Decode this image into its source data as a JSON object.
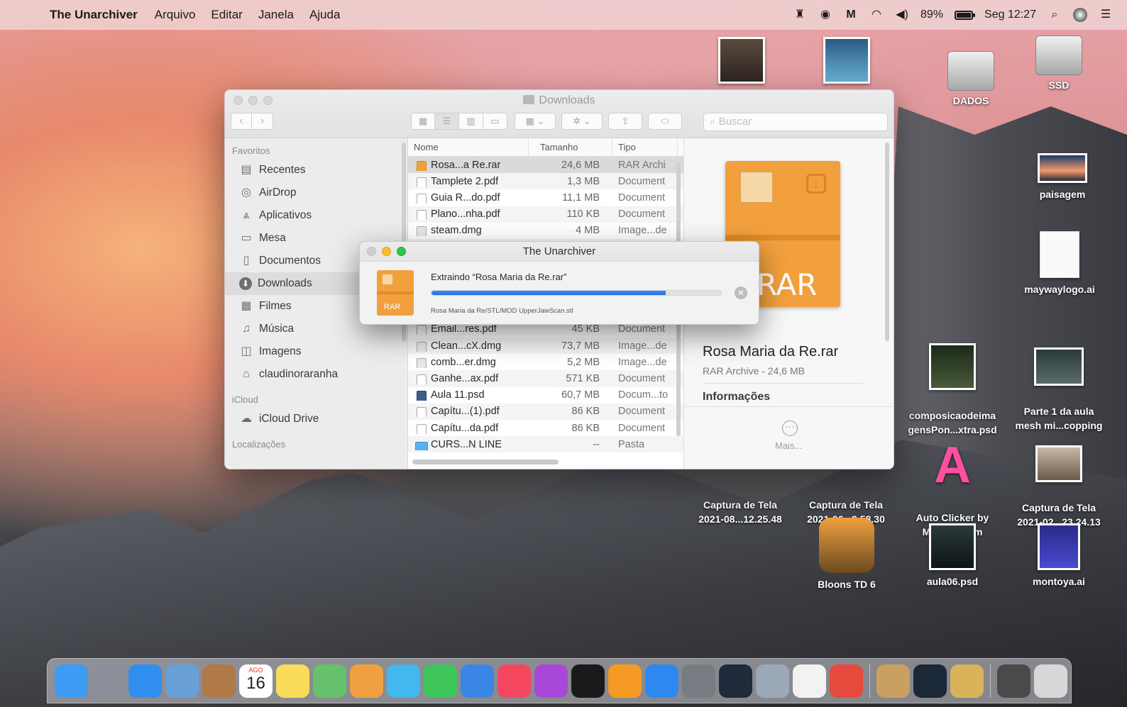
{
  "menubar": {
    "app_name": "The Unarchiver",
    "items": [
      "Arquivo",
      "Editar",
      "Janela",
      "Ajuda"
    ],
    "battery": "89%",
    "battery_level": 0.89,
    "clock": "Seg 12:27"
  },
  "finder": {
    "title": "Downloads",
    "search_placeholder": "Buscar",
    "sidebar": {
      "favorites_label": "Favoritos",
      "favorites": [
        {
          "label": "Recentes",
          "icon": "recents-icon"
        },
        {
          "label": "AirDrop",
          "icon": "airdrop-icon"
        },
        {
          "label": "Aplicativos",
          "icon": "applications-icon"
        },
        {
          "label": "Mesa",
          "icon": "desktop-icon"
        },
        {
          "label": "Documentos",
          "icon": "documents-icon"
        },
        {
          "label": "Downloads",
          "icon": "downloads-icon"
        },
        {
          "label": "Filmes",
          "icon": "movies-icon"
        },
        {
          "label": "Música",
          "icon": "music-icon"
        },
        {
          "label": "Imagens",
          "icon": "pictures-icon"
        },
        {
          "label": "claudinoraranha",
          "icon": "home-icon"
        }
      ],
      "icloud_label": "iCloud",
      "icloud_drive": "iCloud Drive",
      "locations_label": "Localizações"
    },
    "columns": {
      "name": "Nome",
      "size": "Tamanho",
      "kind": "Tipo"
    },
    "files": [
      {
        "name": "Rosa...a Re.rar",
        "size": "24,6 MB",
        "kind": "RAR Archi",
        "type": "rar"
      },
      {
        "name": "Tamplete 2.pdf",
        "size": "1,3 MB",
        "kind": "Document",
        "type": "pdf"
      },
      {
        "name": "Guia R...do.pdf",
        "size": "11,1 MB",
        "kind": "Document",
        "type": "pdf"
      },
      {
        "name": "Plano...nha.pdf",
        "size": "110 KB",
        "kind": "Document",
        "type": "pdf"
      },
      {
        "name": "steam.dmg",
        "size": "4 MB",
        "kind": "Image...de",
        "type": "dmg"
      },
      {
        "name": "",
        "size": "",
        "kind": "",
        "type": "hidden"
      },
      {
        "name": "",
        "size": "",
        "kind": "",
        "type": "hidden"
      },
      {
        "name": "",
        "size": "",
        "kind": "",
        "type": "hidden"
      },
      {
        "name": "",
        "size": "",
        "kind": "",
        "type": "hidden"
      },
      {
        "name": "",
        "size": "",
        "kind": "",
        "type": "hidden"
      },
      {
        "name": "Email...res.pdf",
        "size": "45 KB",
        "kind": "Document",
        "type": "pdf"
      },
      {
        "name": "Clean...cX.dmg",
        "size": "73,7 MB",
        "kind": "Image...de",
        "type": "dmg"
      },
      {
        "name": "comb...er.dmg",
        "size": "5,2 MB",
        "kind": "Image...de",
        "type": "dmg"
      },
      {
        "name": "Ganhe...ax.pdf",
        "size": "571 KB",
        "kind": "Document",
        "type": "pdf"
      },
      {
        "name": "Aula 11.psd",
        "size": "60,7 MB",
        "kind": "Docum...to",
        "type": "psd"
      },
      {
        "name": "Capítu...(1).pdf",
        "size": "86 KB",
        "kind": "Document",
        "type": "pdf"
      },
      {
        "name": "Capítu...da.pdf",
        "size": "86 KB",
        "kind": "Document",
        "type": "pdf"
      },
      {
        "name": "CURS...N LINE",
        "size": "--",
        "kind": "Pasta",
        "type": "folder"
      }
    ],
    "preview": {
      "icon_label": "RAR",
      "title": "Rosa Maria da Re.rar",
      "subtitle": "RAR Archive - 24,6 MB",
      "info_label": "Informações",
      "more_label": "Mais..."
    }
  },
  "dialog": {
    "title": "The Unarchiver",
    "icon_label": "RAR",
    "message": "Extraindo “Rosa Maria da Re.rar”",
    "progress": 0.81,
    "path": "Rosa Maria da Re/STL/MOD UpperJawScan.stl"
  },
  "desktop": [
    {
      "label": "DADOS",
      "kind": "disk"
    },
    {
      "label": "SSD",
      "kind": "disk"
    },
    {
      "label": "paisagem",
      "kind": "thumb"
    },
    {
      "label": "maywaylogo.ai",
      "kind": "file"
    },
    {
      "label": "composicaodeima\ngensPon...xtra.psd",
      "kind": "thumb"
    },
    {
      "label": "Parte 1 da aula\nmesh mi...copping",
      "kind": "thumb"
    },
    {
      "label": "Captura de Tela\n2021-08...12.25.48",
      "kind": "none"
    },
    {
      "label": "Captura de Tela\n2021-06...9.58.30",
      "kind": "none"
    },
    {
      "label": "Auto Clicker by\nMurGaa.com",
      "kind": "app"
    },
    {
      "label": "Captura de Tela\n2021-02...23.24.13",
      "kind": "thumb"
    },
    {
      "label": "Bloons TD 6",
      "kind": "app"
    },
    {
      "label": "aula06.psd",
      "kind": "thumb"
    },
    {
      "label": "montoya.ai",
      "kind": "file"
    }
  ],
  "dock": {
    "calendar_day": "16",
    "calendar_month": "AGO",
    "apps": [
      {
        "name": "finder-icon",
        "color": "#3e9bf3"
      },
      {
        "name": "launchpad-icon",
        "color": "#8a8f99"
      },
      {
        "name": "safari-icon",
        "color": "#2f8ef0"
      },
      {
        "name": "preview-icon",
        "color": "#6aa0d8"
      },
      {
        "name": "contacts-icon",
        "color": "#b07a48"
      },
      {
        "name": "calendar-icon",
        "color": "#ffffff"
      },
      {
        "name": "notes-icon",
        "color": "#f8dc5a"
      },
      {
        "name": "maps-icon",
        "color": "#67c06b"
      },
      {
        "name": "photos-icon",
        "color": "#f0a040"
      },
      {
        "name": "messages-icon",
        "color": "#43b8f0"
      },
      {
        "name": "facetime-icon",
        "color": "#3ec65a"
      },
      {
        "name": "keynote-icon",
        "color": "#3a86e6"
      },
      {
        "name": "music-icon",
        "color": "#f4475f"
      },
      {
        "name": "podcasts-icon",
        "color": "#a748d8"
      },
      {
        "name": "tv-icon",
        "color": "#1a1a1a"
      },
      {
        "name": "books-icon",
        "color": "#f59b23"
      },
      {
        "name": "appstore-icon",
        "color": "#2d88f0"
      },
      {
        "name": "system-preferences-icon",
        "color": "#777b82"
      },
      {
        "name": "quicktime-icon",
        "color": "#1f2a3a"
      },
      {
        "name": "image-capture-icon",
        "color": "#9aa8b8"
      },
      {
        "name": "textedit-icon",
        "color": "#f2f2f2"
      },
      {
        "name": "chrome-icon",
        "color": "#e64a3c"
      },
      {
        "name": "archive-utility-icon",
        "color": "#c8a060"
      },
      {
        "name": "steam-icon",
        "color": "#1b2838"
      },
      {
        "name": "installer-icon",
        "color": "#d9b35a"
      },
      {
        "name": "finder-window-icon",
        "color": "#4a4a4a"
      },
      {
        "name": "trash-icon",
        "color": "#d8d8d8"
      }
    ]
  }
}
